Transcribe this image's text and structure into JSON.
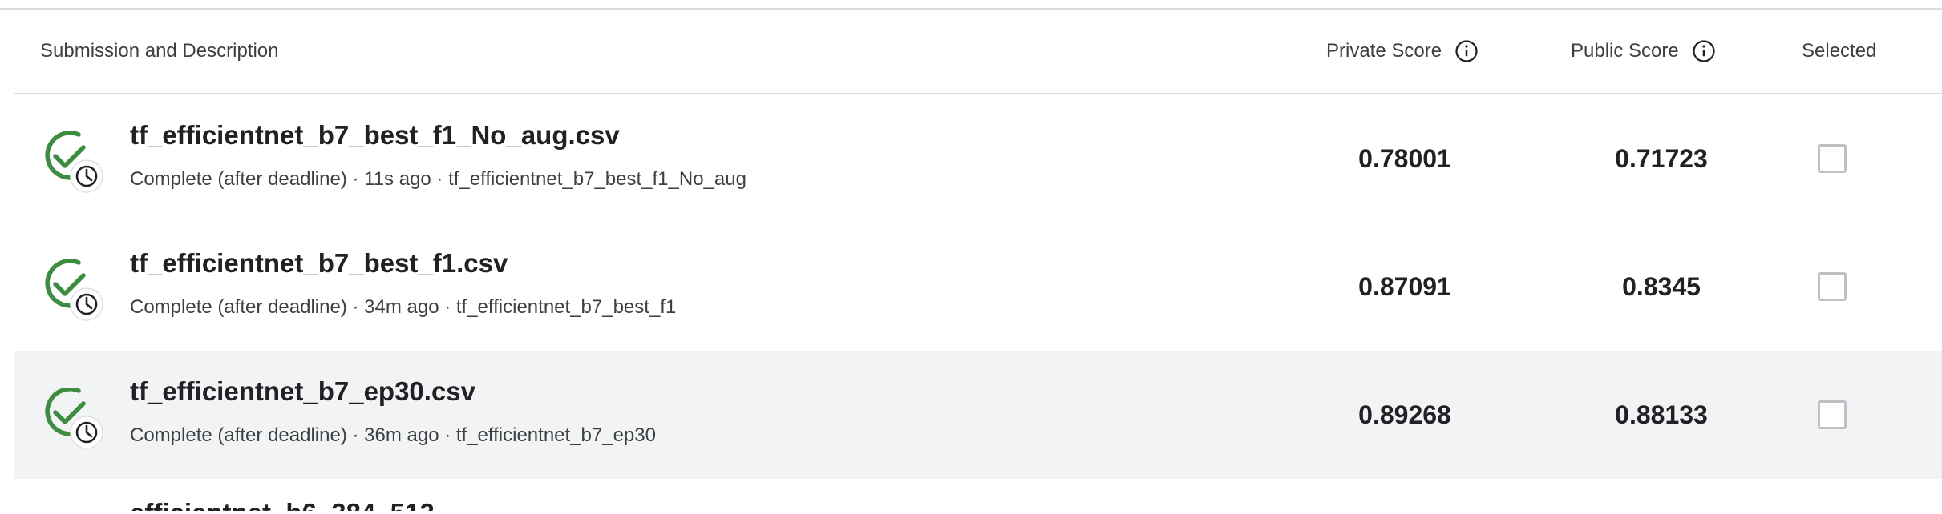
{
  "header": {
    "submission_label": "Submission and Description",
    "private_label": "Private Score",
    "public_label": "Public Score",
    "selected_label": "Selected",
    "info_icon": "info-icon"
  },
  "rows": [
    {
      "title": "tf_efficientnet_b7_best_f1_No_aug.csv",
      "meta": "Complete (after deadline) · 11s ago · tf_efficientnet_b7_best_f1_No_aug",
      "private_score": "0.78001",
      "public_score": "0.71723",
      "selected": false,
      "highlighted": false,
      "status_icon": "check-clock-icon"
    },
    {
      "title": "tf_efficientnet_b7_best_f1.csv",
      "meta": "Complete (after deadline) · 34m ago · tf_efficientnet_b7_best_f1",
      "private_score": "0.87091",
      "public_score": "0.8345",
      "selected": false,
      "highlighted": false,
      "status_icon": "check-clock-icon"
    },
    {
      "title": "tf_efficientnet_b7_ep30.csv",
      "meta": "Complete (after deadline) · 36m ago · tf_efficientnet_b7_ep30",
      "private_score": "0.89268",
      "public_score": "0.88133",
      "selected": false,
      "highlighted": true,
      "status_icon": "check-clock-icon"
    }
  ],
  "partial_row_title": "efficientnet_b6_384_512",
  "colors": {
    "success_green": "#3d8c40",
    "row_highlight": "#f1f3f4",
    "divider": "#dadce0",
    "text_primary": "#202124",
    "text_secondary": "#3c4043"
  }
}
